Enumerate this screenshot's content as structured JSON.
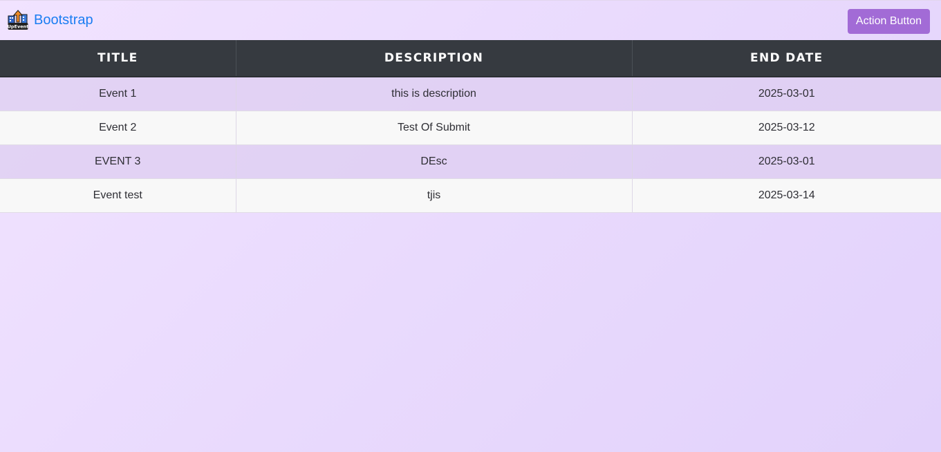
{
  "navbar": {
    "brand_text": "Bootstrap",
    "logo_text": "UpEvent",
    "action_button_label": "Action Button"
  },
  "table": {
    "headers": [
      "TITLE",
      "DESCRIPTION",
      "END DATE"
    ],
    "rows": [
      [
        "Event 1",
        "this is description",
        "2025-03-01"
      ],
      [
        "Event 2",
        "Test Of Submit",
        "2025-03-12"
      ],
      [
        "EVENT 3",
        "DEsc",
        "2025-03-01"
      ],
      [
        "Event test",
        "tjis",
        "2025-03-14"
      ]
    ]
  },
  "colors": {
    "brand": "#1a7df2",
    "action_button": "#a26bd6",
    "table_header": "#363a40",
    "striped_row": "#ddcdf0"
  },
  "icons": {
    "logo": "upevent-logo-icon"
  }
}
